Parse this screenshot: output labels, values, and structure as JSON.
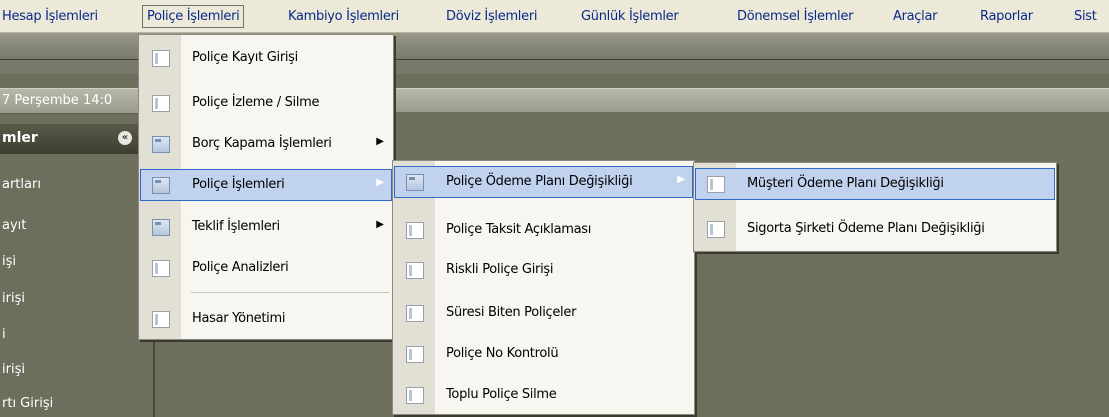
{
  "menubar": {
    "items": [
      "Hesap İşlemleri",
      "Poliçe İşlemleri",
      "Kambiyo İşlemleri",
      "Döviz İşlemleri",
      "Günlük İşlemler",
      "Dönemsel İşlemler",
      "Araçlar",
      "Raporlar",
      "Sist"
    ],
    "active": "Poliçe İşlemleri"
  },
  "datebar": {
    "text": "7 Perşembe 14:0"
  },
  "left_panel": {
    "title": "mler",
    "items": [
      "artları",
      "ayıt",
      "işi",
      "irişi",
      "i",
      "irişi",
      "rtı Girişi"
    ]
  },
  "menu1": {
    "items": [
      {
        "label": "Poliçe Kayıt Girişi",
        "icon": "document-icon",
        "submenu": false
      },
      {
        "label": "Poliçe İzleme / Silme",
        "icon": "document-icon",
        "submenu": false
      },
      {
        "label": "Borç Kapama İşlemleri",
        "icon": "folder-icon",
        "submenu": true
      },
      {
        "label": "Poliçe İşlemleri",
        "icon": "folder-icon",
        "submenu": true,
        "highlighted": true
      },
      {
        "label": "Teklif İşlemleri",
        "icon": "folder-icon",
        "submenu": true
      },
      {
        "label": "Poliçe Analizleri",
        "icon": "document-icon",
        "submenu": false
      },
      {
        "label": "Hasar Yönetimi",
        "icon": "document-icon",
        "submenu": false
      }
    ]
  },
  "menu2": {
    "items": [
      {
        "label": "Poliçe Ödeme Planı Değişikliği",
        "icon": "folder-icon",
        "submenu": true,
        "highlighted": true
      },
      {
        "label": "Poliçe Taksit Açıklaması",
        "icon": "document-icon"
      },
      {
        "label": "Riskli Poliçe Girişi",
        "icon": "document-icon"
      },
      {
        "label": "Süresi Biten Poliçeler",
        "icon": "document-icon"
      },
      {
        "label": "Poliçe No Kontrolü",
        "icon": "document-icon"
      },
      {
        "label": "Toplu Poliçe Silme",
        "icon": "document-icon"
      }
    ]
  },
  "menu3": {
    "items": [
      {
        "label": "Müşteri Ödeme Planı Değişikliği",
        "icon": "document-icon",
        "highlighted": true
      },
      {
        "label": "Sigorta Şirketi Ödeme Planı Değişikliği",
        "icon": "document-icon"
      }
    ]
  },
  "colors": {
    "highlight": "#c1d2ee",
    "highlight_border": "#316ac5",
    "workspace": "#6e6e5c"
  }
}
